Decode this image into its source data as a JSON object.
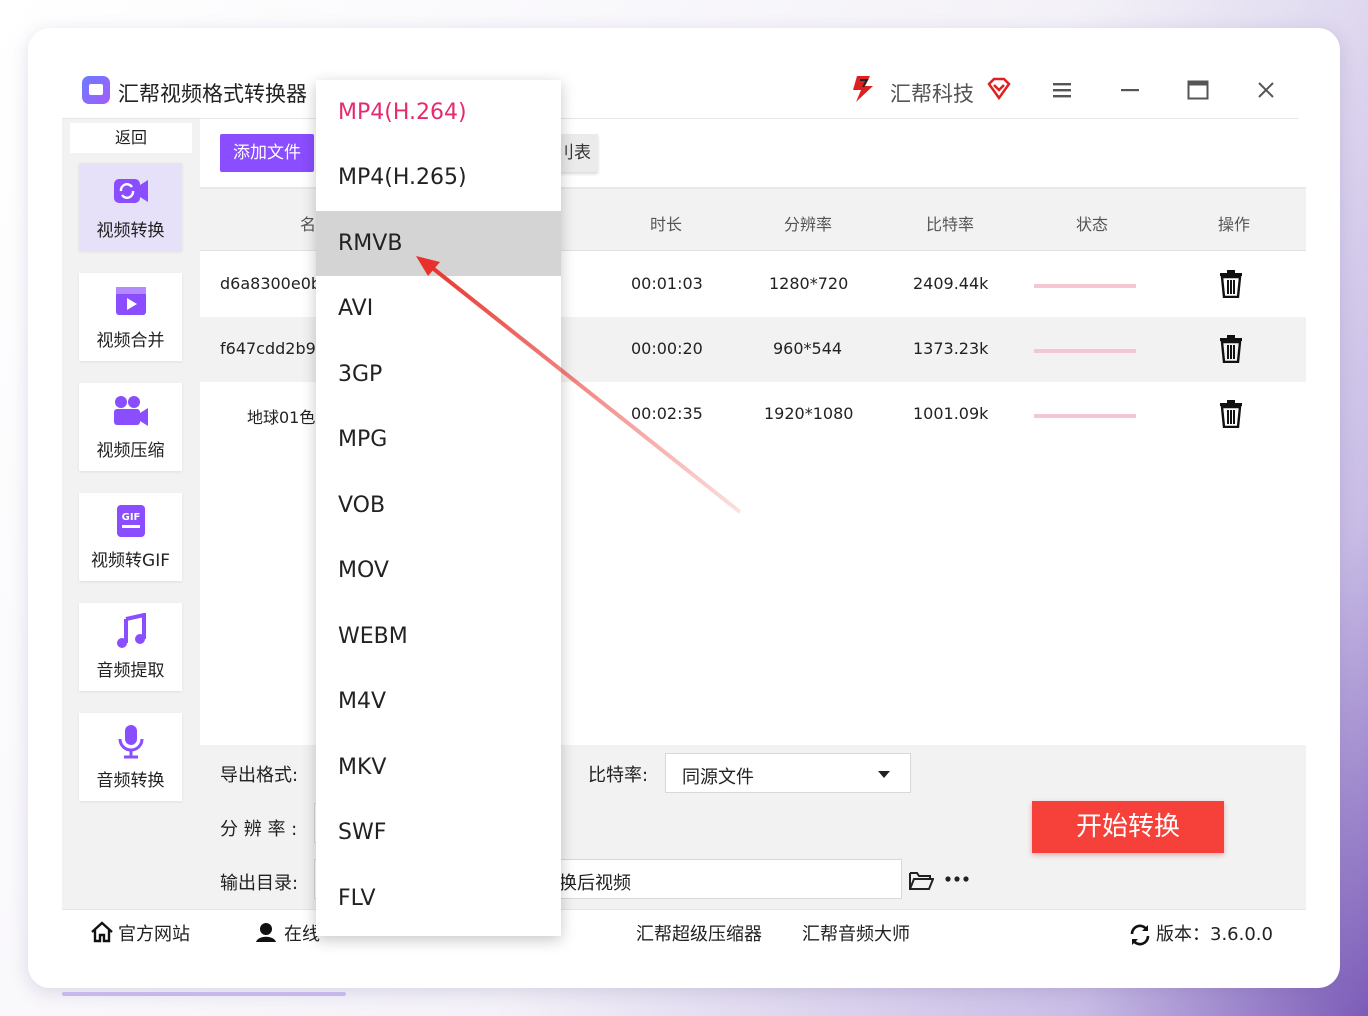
{
  "app": {
    "title": "汇帮视频格式转换器",
    "brand": "汇帮科技"
  },
  "colors": {
    "accent": "#8a4dff",
    "start": "#f5413a",
    "selected": "#e52a6f"
  },
  "sidebar": {
    "back": "返回",
    "items": [
      {
        "label": "视频转换",
        "icon": "video-convert-icon",
        "active": true
      },
      {
        "label": "视频合并",
        "icon": "video-merge-icon"
      },
      {
        "label": "视频压缩",
        "icon": "video-compress-icon"
      },
      {
        "label": "视频转GIF",
        "icon": "gif-icon"
      },
      {
        "label": "音频提取",
        "icon": "music-note-icon"
      },
      {
        "label": "音频转换",
        "icon": "microphone-icon"
      }
    ]
  },
  "toolbar": {
    "add": "添加文件",
    "clear_partial": "刂表"
  },
  "table": {
    "headers": [
      "名",
      "时长",
      "分辨率",
      "比特率",
      "状态",
      "操作"
    ],
    "rows": [
      {
        "name": "d6a8300e0b",
        "duration": "00:01:03",
        "resolution": "1280*720",
        "bitrate": "2409.44k"
      },
      {
        "name": "f647cdd2b9",
        "duration": "00:00:20",
        "resolution": "960*544",
        "bitrate": "1373.23k"
      },
      {
        "name": "地球01色",
        "duration": "00:02:35",
        "resolution": "1920*1080",
        "bitrate": "1001.09k"
      }
    ]
  },
  "settings": {
    "format_label": "导出格式:",
    "bitrate_label": "比特率:",
    "bitrate_value": "同源文件",
    "resolution_label": "分 辨 率 :",
    "outdir_label": "输出目录:",
    "outdir_value": "换后视频",
    "start": "开始转换"
  },
  "footer": {
    "website": "官方网站",
    "online_partial": "在线",
    "compressor": "汇帮超级压缩器",
    "audio_master": "汇帮音频大师",
    "version": "版本：3.6.0.0"
  },
  "dropdown": {
    "options": [
      "MP4(H.264)",
      "MP4(H.265)",
      "RMVB",
      "AVI",
      "3GP",
      "MPG",
      "VOB",
      "MOV",
      "WEBM",
      "M4V",
      "MKV",
      "SWF",
      "FLV"
    ],
    "selected_index": 0,
    "hover_index": 2
  }
}
